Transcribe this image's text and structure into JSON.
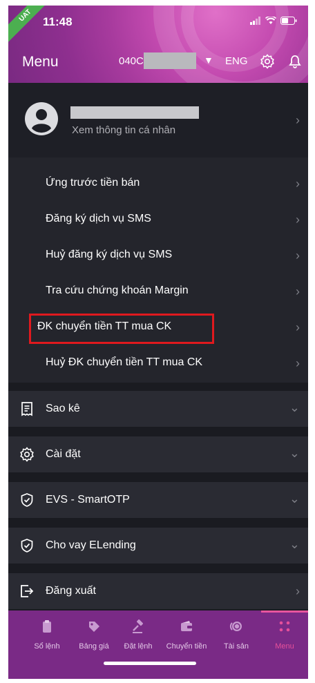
{
  "status_bar": {
    "time": "11:48",
    "env_badge": "UAT"
  },
  "header": {
    "title": "Menu",
    "account_prefix": "040C",
    "language": "ENG"
  },
  "profile": {
    "subtitle": "Xem thông tin cá nhân"
  },
  "submenu": [
    {
      "label": "Ứng trước tiền bán"
    },
    {
      "label": "Đăng ký dịch vụ SMS"
    },
    {
      "label": "Huỷ đăng ký dịch vụ SMS"
    },
    {
      "label": "Tra cứu chứng khoán Margin"
    },
    {
      "label": "ĐK chuyển tiền TT mua CK",
      "highlighted": true
    },
    {
      "label": "Huỷ ĐK chuyển tiền TT mua CK"
    }
  ],
  "sections": [
    {
      "label": "Sao kê",
      "icon": "receipt-icon"
    },
    {
      "label": "Cài đặt",
      "icon": "gear-icon"
    },
    {
      "label": "EVS - SmartOTP",
      "icon": "shield-check-icon"
    },
    {
      "label": "Cho vay ELending",
      "icon": "shield-check-icon"
    },
    {
      "label": "Đăng xuất",
      "icon": "logout-icon"
    }
  ],
  "tabs": [
    {
      "label": "Sổ lệnh",
      "icon": "clipboard-icon"
    },
    {
      "label": "Bảng giá",
      "icon": "tag-icon"
    },
    {
      "label": "Đặt lệnh",
      "icon": "hammer-icon"
    },
    {
      "label": "Chuyển tiền",
      "icon": "wallet-icon"
    },
    {
      "label": "Tài sản",
      "icon": "coins-icon"
    },
    {
      "label": "Menu",
      "icon": "grid-icon",
      "active": true
    }
  ],
  "colors": {
    "accent": "#e6509a",
    "header": "#a83b9e",
    "tabbar": "#7a2a86",
    "highlight_border": "#e0191e"
  }
}
